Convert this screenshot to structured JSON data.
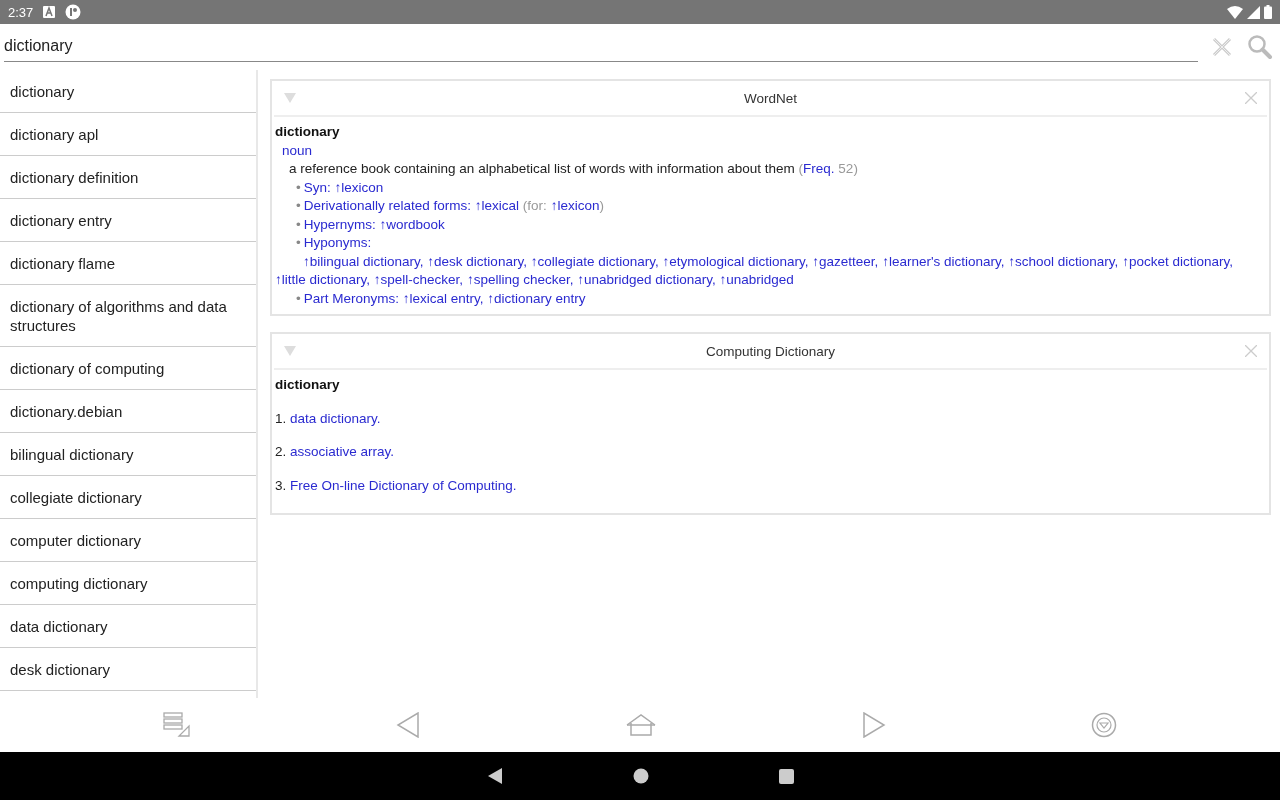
{
  "status_bar": {
    "time": "2:37"
  },
  "search": {
    "value": "dictionary"
  },
  "sidebar": {
    "items": [
      {
        "label": "dictionary"
      },
      {
        "label": "dictionary apl"
      },
      {
        "label": "dictionary definition"
      },
      {
        "label": "dictionary entry"
      },
      {
        "label": "dictionary flame"
      },
      {
        "label": "dictionary of algorithms and data structures"
      },
      {
        "label": "dictionary of computing"
      },
      {
        "label": "dictionary.debian"
      },
      {
        "label": "bilingual dictionary"
      },
      {
        "label": "collegiate dictionary"
      },
      {
        "label": "computer dictionary"
      },
      {
        "label": "computing dictionary"
      },
      {
        "label": "data dictionary"
      },
      {
        "label": "desk dictionary"
      }
    ]
  },
  "articles": [
    {
      "kind": "wordnet",
      "title": "WordNet",
      "headword": "dictionary",
      "pos": "noun",
      "definition": "a reference book containing an alphabetical list of words with information about them",
      "freq_open": "(",
      "freq_label": "Freq.",
      "freq_value": "52",
      "freq_close": ")",
      "relations": [
        {
          "kind": "inline",
          "bullet": "•",
          "label": "Syn:",
          "links": [
            "↑lexicon"
          ]
        },
        {
          "kind": "inline",
          "bullet": "•",
          "label": "Derivationally related forms:",
          "links": [
            "↑lexical"
          ],
          "note": {
            "prefix": "(for:",
            "link": "↑lexicon",
            "suffix": ")"
          }
        },
        {
          "kind": "inline",
          "bullet": "•",
          "label": "Hypernyms:",
          "links": [
            "↑wordbook"
          ]
        },
        {
          "kind": "block",
          "bullet": "•",
          "label": "Hyponyms:",
          "links": [
            "↑bilingual dictionary,",
            "↑desk dictionary,",
            "↑collegiate dictionary,",
            "↑etymological dictionary,",
            "↑gazetteer,",
            "↑learner's dictionary,",
            "↑school dictionary,",
            "↑pocket dictionary,",
            "↑little dictionary,",
            "↑spell-checker,",
            "↑spelling checker,",
            "↑unabridged dictionary,",
            "↑unabridged"
          ]
        },
        {
          "kind": "inline",
          "bullet": "•",
          "label": "Part Meronyms:",
          "links": [
            "↑lexical entry,",
            "↑dictionary entry"
          ]
        }
      ]
    },
    {
      "kind": "numbered",
      "title": "Computing Dictionary",
      "headword": "dictionary",
      "items": [
        {
          "number": "1.",
          "link": "data dictionary."
        },
        {
          "number": "2.",
          "link": "associative array."
        },
        {
          "number": "3.",
          "link": "Free On-line Dictionary of Computing."
        }
      ]
    }
  ]
}
